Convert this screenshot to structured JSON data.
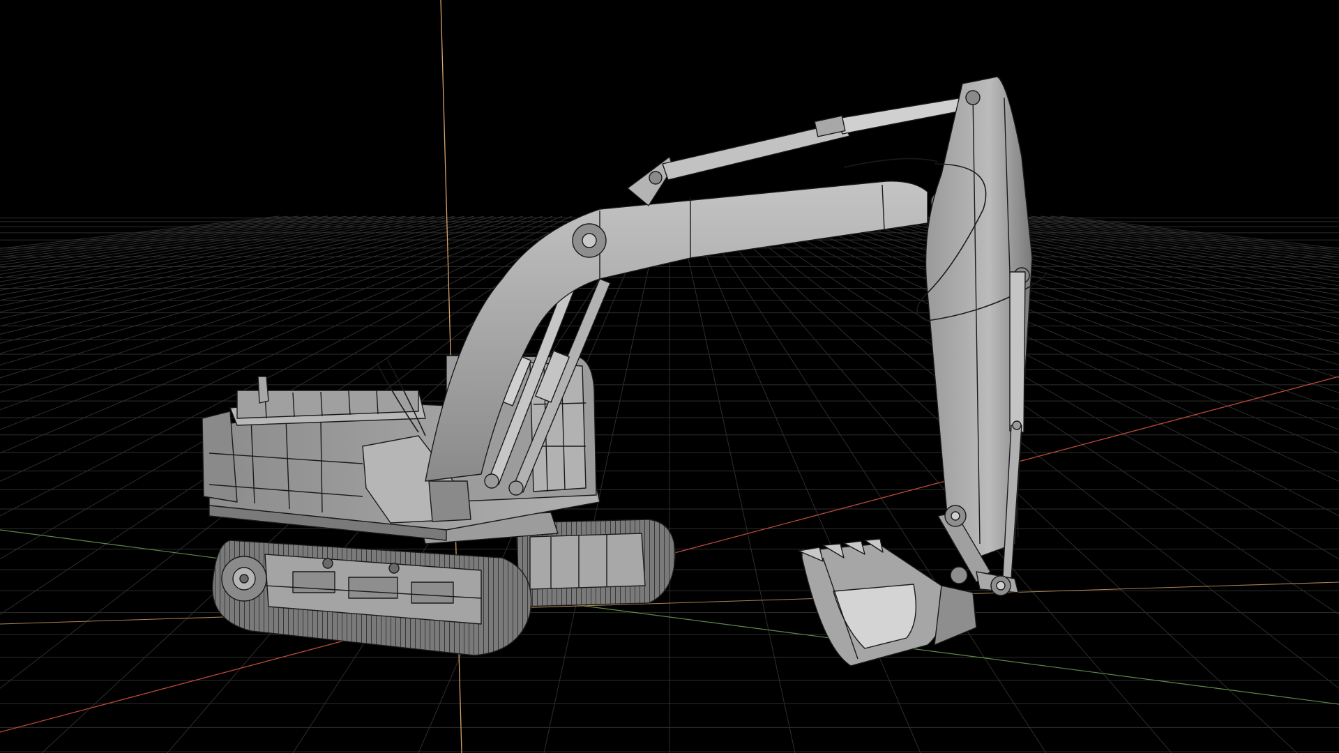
{
  "viewport": {
    "background": "#000000",
    "grid_color": "#2e2e2e",
    "grid_major_color": "#3a3a3a",
    "axis_x_color": "#b84a3a",
    "axis_y_color": "#5f8a4a",
    "axis_z_color": "#d9a26a",
    "model_fill": "#9a9a9a",
    "model_fill_light": "#bdbdbd",
    "model_fill_dark": "#6e6e6e",
    "wire_color": "#1a1a1a",
    "display_mode": "wireframe-on-shaded"
  },
  "scene": {
    "object": "excavator-model",
    "parts": [
      "tracks",
      "undercarriage",
      "upper-house",
      "engine-cover",
      "cab",
      "boom",
      "boom-cylinders",
      "stick",
      "stick-cylinder",
      "bucket",
      "bucket-cylinder",
      "exhaust-stack",
      "hydraulic-hoses"
    ]
  }
}
